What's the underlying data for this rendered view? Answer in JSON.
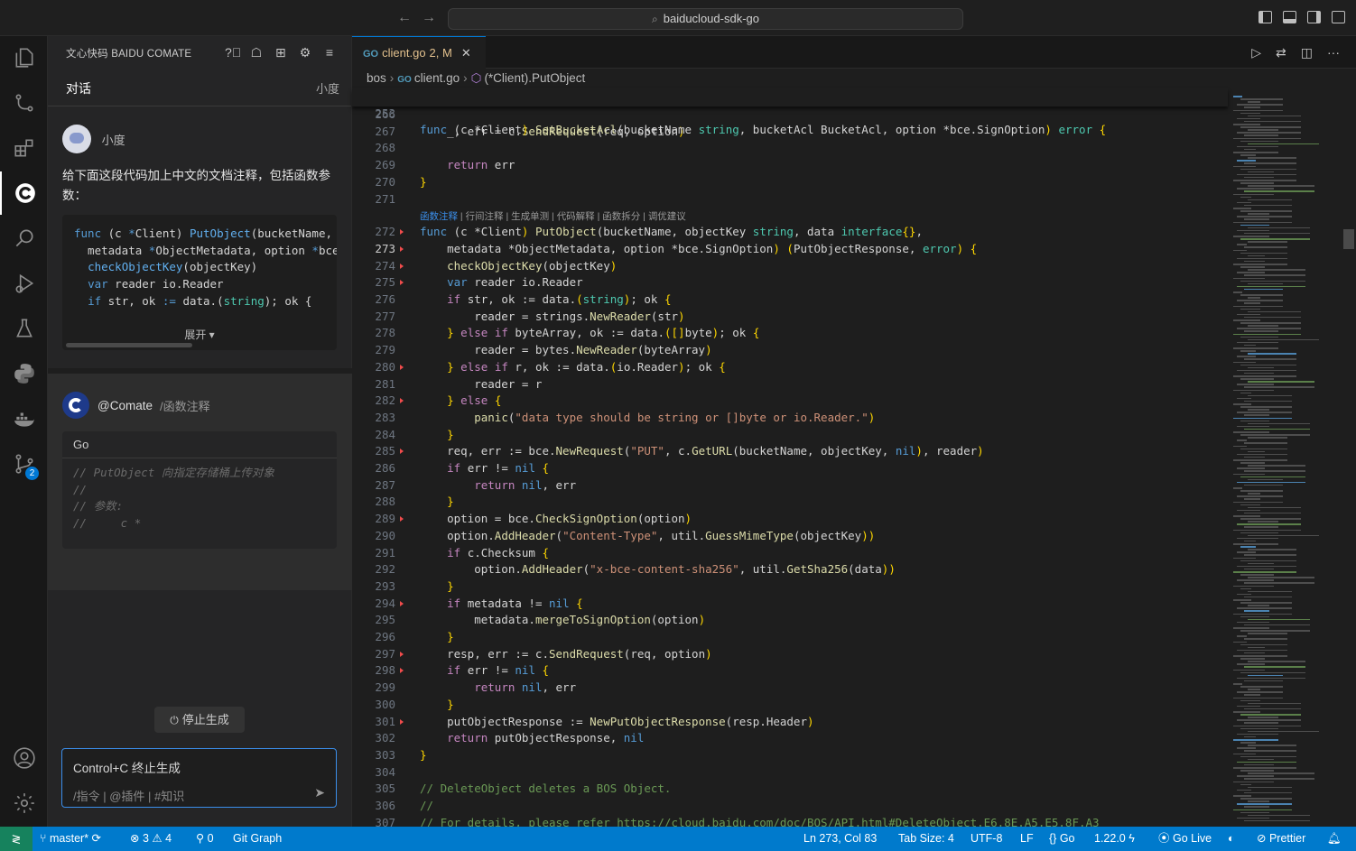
{
  "titlebar": {
    "search_text": "baiducloud-sdk-go"
  },
  "activity": {
    "scm_badge": "2"
  },
  "comate": {
    "header_title": "文心快码 BAIDU COMATE",
    "tab_chat": "对话",
    "tab_right": "小度",
    "user_name": "小度",
    "question": "给下面这段代码加上中文的文档注释，包括函数参数：",
    "code_lines": [
      "func (c *Client) PutObject(bucketName,",
      "  metadata *ObjectMetadata, option *bce",
      "  checkObjectKey(objectKey)",
      "  var reader io.Reader",
      "  if str, ok := data.(string); ok {"
    ],
    "expand_label": "展开 ▾",
    "bot_name": "@Comate",
    "bot_command": "/函数注释",
    "answer_lang": "Go",
    "answer_lines": [
      "// PutObject 向指定存储桶上传对象",
      "//",
      "// 参数:",
      "//     c *"
    ],
    "stop_label": "停止生成",
    "input_placeholder": "Control+C 终止生成",
    "input_options": "/指令  |  @插件  |  #知识"
  },
  "editor": {
    "tab_filename": "client.go",
    "tab_status": "2, M",
    "breadcrumb": [
      "bos",
      "client.go",
      "(*Client).PutObject"
    ],
    "sticky_line_number": "253",
    "sticky_code": "func (c *Client) SetBucketAcl(bucketName string, bucketAcl BucketAcl, option *bce.SignOption) error {",
    "codelens": [
      "函数注释",
      "行间注释",
      "生成单测",
      "代码解释",
      "函数拆分",
      "调优建议"
    ],
    "lines_before_lens": [
      {
        "n": "266",
        "code": ""
      },
      {
        "n": "267",
        "code": "    _, err = c.SendRequest(req, option)"
      },
      {
        "n": "268",
        "code": ""
      },
      {
        "n": "269",
        "code": "    return err"
      },
      {
        "n": "270",
        "code": "}"
      },
      {
        "n": "271",
        "code": ""
      }
    ],
    "lines_after_lens": [
      {
        "n": "272",
        "code": "func (c *Client) PutObject(bucketName, objectKey string, data interface{},"
      },
      {
        "n": "273",
        "code": "    metadata *ObjectMetadata, option *bce.SignOption) (PutObjectResponse, error) {"
      },
      {
        "n": "274",
        "code": "    checkObjectKey(objectKey)"
      },
      {
        "n": "275",
        "code": "    var reader io.Reader"
      },
      {
        "n": "276",
        "code": "    if str, ok := data.(string); ok {"
      },
      {
        "n": "277",
        "code": "        reader = strings.NewReader(str)"
      },
      {
        "n": "278",
        "code": "    } else if byteArray, ok := data.([]byte); ok {"
      },
      {
        "n": "279",
        "code": "        reader = bytes.NewReader(byteArray)"
      },
      {
        "n": "280",
        "code": "    } else if r, ok := data.(io.Reader); ok {"
      },
      {
        "n": "281",
        "code": "        reader = r"
      },
      {
        "n": "282",
        "code": "    } else {"
      },
      {
        "n": "283",
        "code": "        panic(\"data type should be string or []byte or io.Reader.\")"
      },
      {
        "n": "284",
        "code": "    }"
      },
      {
        "n": "285",
        "code": "    req, err := bce.NewRequest(\"PUT\", c.GetURL(bucketName, objectKey, nil), reader)"
      },
      {
        "n": "286",
        "code": "    if err != nil {"
      },
      {
        "n": "287",
        "code": "        return nil, err"
      },
      {
        "n": "288",
        "code": "    }"
      },
      {
        "n": "289",
        "code": "    option = bce.CheckSignOption(option)"
      },
      {
        "n": "290",
        "code": "    option.AddHeader(\"Content-Type\", util.GuessMimeType(objectKey))"
      },
      {
        "n": "291",
        "code": "    if c.Checksum {"
      },
      {
        "n": "292",
        "code": "        option.AddHeader(\"x-bce-content-sha256\", util.GetSha256(data))"
      },
      {
        "n": "293",
        "code": "    }"
      },
      {
        "n": "294",
        "code": "    if metadata != nil {"
      },
      {
        "n": "295",
        "code": "        metadata.mergeToSignOption(option)"
      },
      {
        "n": "296",
        "code": "    }"
      },
      {
        "n": "297",
        "code": "    resp, err := c.SendRequest(req, option)"
      },
      {
        "n": "298",
        "code": "    if err != nil {"
      },
      {
        "n": "299",
        "code": "        return nil, err"
      },
      {
        "n": "300",
        "code": "    }"
      },
      {
        "n": "301",
        "code": "    putObjectResponse := NewPutObjectResponse(resp.Header)"
      },
      {
        "n": "302",
        "code": "    return putObjectResponse, nil"
      },
      {
        "n": "303",
        "code": "}"
      },
      {
        "n": "304",
        "code": ""
      },
      {
        "n": "305",
        "code": "// DeleteObject deletes a BOS Object."
      },
      {
        "n": "306",
        "code": "//"
      },
      {
        "n": "307",
        "code": "// For details, please refer https://cloud.baidu.com/doc/BOS/API.html#DeleteObject.E6.8E.A5.E5.8F.A3"
      }
    ],
    "current_line": "273"
  },
  "statusbar": {
    "branch": "master*",
    "errors": "3",
    "warnings": "4",
    "ports": "0",
    "git_graph": "Git Graph",
    "cursor": "Ln 273, Col 83",
    "tab_size": "Tab Size: 4",
    "encoding": "UTF-8",
    "eol": "LF",
    "language": "Go",
    "go_version": "1.22.0",
    "go_live": "Go Live",
    "prettier": "Prettier"
  },
  "colors": {
    "accent": "#007acc",
    "remote": "#16825d",
    "focus": "#3b8eea"
  }
}
